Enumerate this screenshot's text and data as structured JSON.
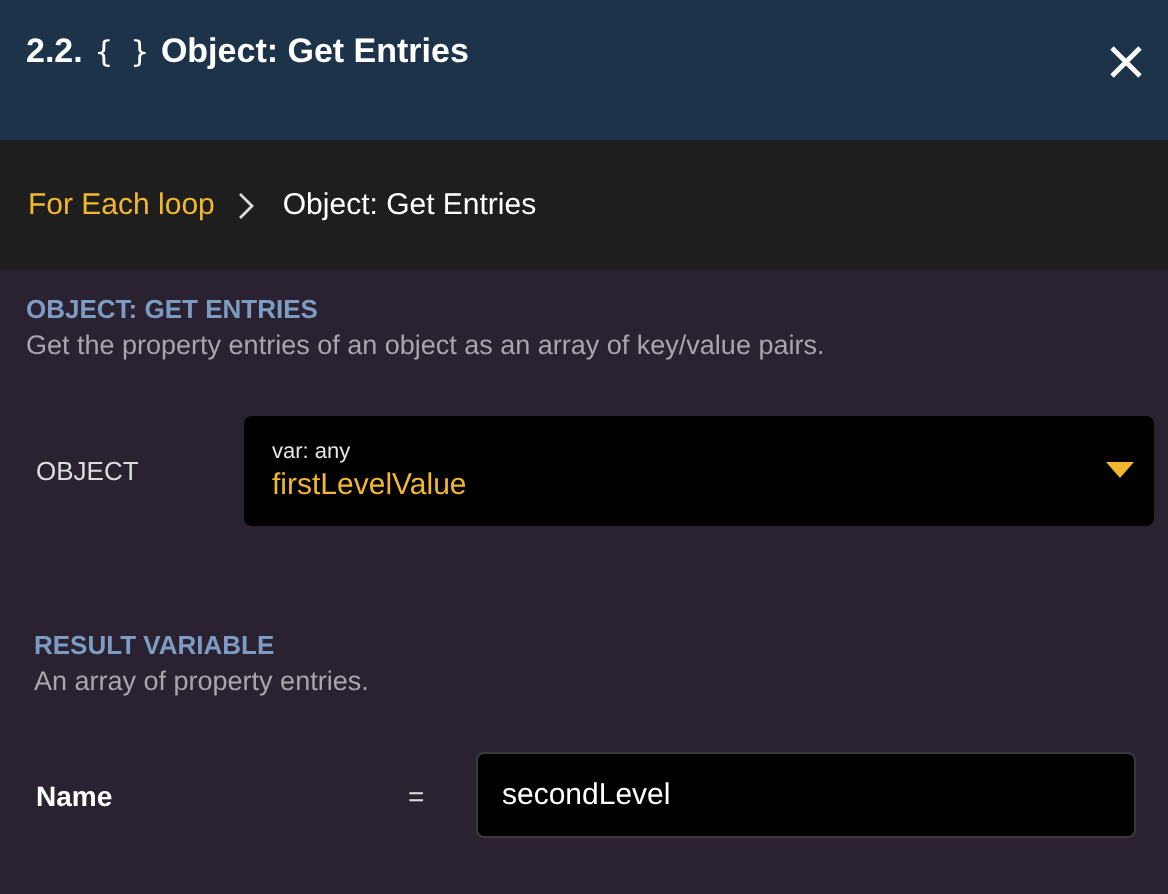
{
  "header": {
    "number": "2.2.",
    "icon_text": "{ }",
    "title": "Object: Get Entries"
  },
  "breadcrumb": [
    {
      "label": "For Each loop",
      "selected": false
    },
    {
      "label": "Object: Get Entries",
      "selected": true
    }
  ],
  "section": {
    "heading": "OBJECT: GET ENTRIES",
    "description": "Get the property entries of an object as an array of key/value pairs.",
    "field": {
      "label": "OBJECT",
      "type_hint": "var: any",
      "value": "firstLevelValue"
    }
  },
  "result": {
    "heading": "RESULT VARIABLE",
    "description": "An array of property entries.",
    "field": {
      "label": "Name",
      "operator": "=",
      "value": "secondLevel"
    }
  }
}
